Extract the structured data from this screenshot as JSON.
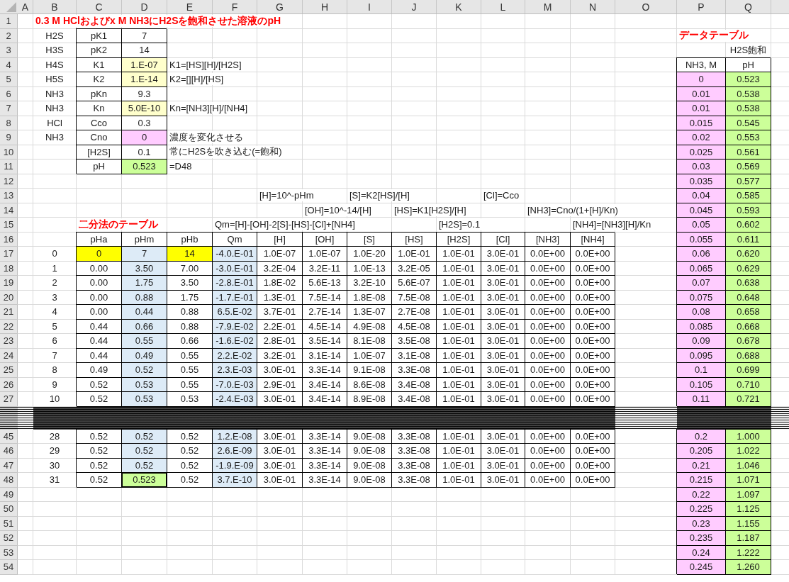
{
  "columns": [
    "A",
    "B",
    "C",
    "D",
    "E",
    "F",
    "G",
    "H",
    "I",
    "J",
    "K",
    "L",
    "M",
    "N",
    "O",
    "P",
    "Q"
  ],
  "rows": [
    {
      "kind": "row",
      "number": "1",
      "cells": [
        null,
        {
          "text": "0.3 M HClおよびx M NH3にH2Sを飽和させた溶液のpH",
          "kind": "title"
        }
      ]
    },
    {
      "kind": "row",
      "number": "2",
      "cells": [
        null,
        {
          "text": "H2S"
        },
        {
          "text": "pK1",
          "boxed": true
        },
        {
          "text": "7",
          "boxed": true
        },
        null,
        null,
        null,
        null,
        null,
        null,
        null,
        null,
        null,
        null,
        null,
        {
          "text": "データテーブル",
          "kind": "title"
        }
      ]
    },
    {
      "kind": "row",
      "number": "3",
      "cells": [
        null,
        {
          "text": "H3S"
        },
        {
          "text": "pK2",
          "boxed": true
        },
        {
          "text": "14",
          "boxed": true
        },
        null,
        null,
        null,
        null,
        null,
        null,
        null,
        null,
        null,
        null,
        null,
        null,
        {
          "text": "H2S飽和"
        }
      ]
    },
    {
      "kind": "row",
      "number": "4",
      "cells": [
        null,
        {
          "text": "H4S"
        },
        {
          "text": "K1",
          "boxed": true
        },
        {
          "text": "1.E-07",
          "boxed": true,
          "color": "#ffffcc"
        },
        {
          "text": "K1=[HS][H]/[H2S]",
          "kind": "note"
        },
        null,
        null,
        null,
        null,
        null,
        null,
        null,
        null,
        null,
        null,
        {
          "text": "NH3, M",
          "boxed": true
        },
        {
          "text": "pH",
          "boxed": true
        }
      ]
    },
    {
      "kind": "row",
      "number": "5",
      "cells": [
        null,
        {
          "text": "H5S"
        },
        {
          "text": "K2",
          "boxed": true
        },
        {
          "text": "1.E-14",
          "boxed": true,
          "color": "#ffffcc"
        },
        {
          "text": "K2=[][H]/[HS]",
          "kind": "note"
        },
        null,
        null,
        null,
        null,
        null,
        null,
        null,
        null,
        null,
        null,
        {
          "text": "0",
          "boxed": true,
          "color": "#ffccff"
        },
        {
          "text": "0.523",
          "boxed": true,
          "color": "#ccff99"
        }
      ]
    },
    {
      "kind": "row",
      "number": "6",
      "cells": [
        null,
        {
          "text": "NH3"
        },
        {
          "text": "pKn",
          "boxed": true
        },
        {
          "text": "9.3",
          "boxed": true
        },
        null,
        null,
        null,
        null,
        null,
        null,
        null,
        null,
        null,
        null,
        null,
        {
          "text": "0.01",
          "boxed": true,
          "color": "#ffccff"
        },
        {
          "text": "0.538",
          "boxed": true,
          "color": "#ccff99"
        }
      ]
    },
    {
      "kind": "row",
      "number": "7",
      "cells": [
        null,
        {
          "text": "NH3"
        },
        {
          "text": "Kn",
          "boxed": true
        },
        {
          "text": "5.0E-10",
          "boxed": true,
          "color": "#ffffcc"
        },
        {
          "text": "Kn=[NH3][H]/[NH4]",
          "kind": "note"
        },
        null,
        null,
        null,
        null,
        null,
        null,
        null,
        null,
        null,
        null,
        {
          "text": "0.01",
          "boxed": true,
          "color": "#ffccff"
        },
        {
          "text": "0.538",
          "boxed": true,
          "color": "#ccff99"
        }
      ]
    },
    {
      "kind": "row",
      "number": "8",
      "cells": [
        null,
        {
          "text": "HCl"
        },
        {
          "text": "Cco",
          "boxed": true
        },
        {
          "text": "0.3",
          "boxed": true
        },
        null,
        null,
        null,
        null,
        null,
        null,
        null,
        null,
        null,
        null,
        null,
        {
          "text": "0.015",
          "boxed": true,
          "color": "#ffccff"
        },
        {
          "text": "0.545",
          "boxed": true,
          "color": "#ccff99"
        }
      ]
    },
    {
      "kind": "row",
      "number": "9",
      "cells": [
        null,
        {
          "text": "NH3"
        },
        {
          "text": "Cno",
          "boxed": true
        },
        {
          "text": "0",
          "boxed": true,
          "color": "#ffccff"
        },
        {
          "text": "濃度を変化させる",
          "kind": "note"
        },
        null,
        null,
        null,
        null,
        null,
        null,
        null,
        null,
        null,
        null,
        {
          "text": "0.02",
          "boxed": true,
          "color": "#ffccff"
        },
        {
          "text": "0.553",
          "boxed": true,
          "color": "#ccff99"
        }
      ]
    },
    {
      "kind": "row",
      "number": "10",
      "cells": [
        null,
        null,
        {
          "text": "[H2S]",
          "boxed": true
        },
        {
          "text": "0.1",
          "boxed": true
        },
        {
          "text": "常にH2Sを吹き込む(=飽和)",
          "kind": "note"
        },
        null,
        null,
        null,
        null,
        null,
        null,
        null,
        null,
        null,
        null,
        {
          "text": "0.025",
          "boxed": true,
          "color": "#ffccff"
        },
        {
          "text": "0.561",
          "boxed": true,
          "color": "#ccff99"
        }
      ]
    },
    {
      "kind": "row",
      "number": "11",
      "cells": [
        null,
        null,
        {
          "text": "pH",
          "boxed": true
        },
        {
          "text": "0.523",
          "boxed": true,
          "color": "#ccff99"
        },
        {
          "text": "=D48",
          "kind": "note"
        },
        null,
        null,
        null,
        null,
        null,
        null,
        null,
        null,
        null,
        null,
        {
          "text": "0.03",
          "boxed": true,
          "color": "#ffccff"
        },
        {
          "text": "0.569",
          "boxed": true,
          "color": "#ccff99"
        }
      ]
    },
    {
      "kind": "row",
      "number": "12",
      "cells": [
        null,
        null,
        null,
        null,
        null,
        null,
        null,
        null,
        null,
        null,
        null,
        null,
        null,
        null,
        null,
        {
          "text": "0.035",
          "boxed": true,
          "color": "#ffccff"
        },
        {
          "text": "0.577",
          "boxed": true,
          "color": "#ccff99"
        }
      ]
    },
    {
      "kind": "row",
      "number": "13",
      "cells": [
        null,
        null,
        null,
        null,
        null,
        null,
        {
          "text": "[H]=10^-pHm",
          "kind": "note"
        },
        null,
        {
          "text": "[S]=K2[HS]/[H]",
          "kind": "note"
        },
        null,
        null,
        {
          "text": "[Cl]=Cco",
          "kind": "note"
        },
        null,
        null,
        null,
        {
          "text": "0.04",
          "boxed": true,
          "color": "#ffccff"
        },
        {
          "text": "0.585",
          "boxed": true,
          "color": "#ccff99"
        }
      ]
    },
    {
      "kind": "row",
      "number": "14",
      "cells": [
        null,
        null,
        null,
        null,
        null,
        null,
        null,
        {
          "text": "[OH]=10^-14/[H]",
          "kind": "note"
        },
        null,
        {
          "text": "[HS]=K1[H2S]/[H]",
          "kind": "note"
        },
        null,
        null,
        {
          "text": "[NH3]=Cno/(1+[H]/Kn)",
          "kind": "note"
        },
        null,
        null,
        {
          "text": "0.045",
          "boxed": true,
          "color": "#ffccff"
        },
        {
          "text": "0.593",
          "boxed": true,
          "color": "#ccff99"
        }
      ]
    },
    {
      "kind": "row",
      "number": "15",
      "cells": [
        null,
        null,
        {
          "text": "二分法のテーブル",
          "kind": "title"
        },
        null,
        null,
        {
          "text": "Qm=[H]-[OH]-2[S]-[HS]-[Cl]+[NH4]",
          "kind": "note"
        },
        null,
        null,
        null,
        null,
        {
          "text": "[H2S]=0.1",
          "kind": "note"
        },
        null,
        null,
        {
          "text": "[NH4]=[NH3][H]/Kn",
          "kind": "note"
        },
        null,
        {
          "text": "0.05",
          "boxed": true,
          "color": "#ffccff"
        },
        {
          "text": "0.602",
          "boxed": true,
          "color": "#ccff99"
        }
      ]
    },
    {
      "kind": "row",
      "number": "16",
      "cells": [
        null,
        null,
        {
          "text": "pHa",
          "boxed": true
        },
        {
          "text": "pHm",
          "boxed": true
        },
        {
          "text": "pHb",
          "boxed": true
        },
        {
          "text": "Qm",
          "boxed": true
        },
        {
          "text": "[H]",
          "boxed": true
        },
        {
          "text": "[OH]",
          "boxed": true
        },
        {
          "text": "[S]",
          "boxed": true
        },
        {
          "text": "[HS]",
          "boxed": true
        },
        {
          "text": "[H2S]",
          "boxed": true
        },
        {
          "text": "[Cl]",
          "boxed": true
        },
        {
          "text": "[NH3]",
          "boxed": true
        },
        {
          "text": "[NH4]",
          "boxed": true
        },
        null,
        {
          "text": "0.055",
          "boxed": true,
          "color": "#ffccff"
        },
        {
          "text": "0.611",
          "boxed": true,
          "color": "#ccff99"
        }
      ]
    },
    {
      "kind": "row",
      "number": "17",
      "cells": [
        null,
        {
          "text": "0"
        },
        {
          "text": "0",
          "boxed": true,
          "color": "#ffff00"
        },
        {
          "text": "7",
          "boxed": true,
          "color": "#ddebf7"
        },
        {
          "text": "14",
          "boxed": true,
          "color": "#ffff00"
        },
        {
          "text": "-4.0.E-01",
          "boxed": true,
          "color": "#ddebf7"
        },
        {
          "text": "1.0E-07",
          "boxed": true
        },
        {
          "text": "1.0E-07",
          "boxed": true
        },
        {
          "text": "1.0E-20",
          "boxed": true
        },
        {
          "text": "1.0E-01",
          "boxed": true
        },
        {
          "text": "1.0E-01",
          "boxed": true
        },
        {
          "text": "3.0E-01",
          "boxed": true
        },
        {
          "text": "0.0E+00",
          "boxed": true
        },
        {
          "text": "0.0E+00",
          "boxed": true
        },
        null,
        {
          "text": "0.06",
          "boxed": true,
          "color": "#ffccff"
        },
        {
          "text": "0.620",
          "boxed": true,
          "color": "#ccff99"
        }
      ]
    },
    {
      "kind": "row",
      "number": "18",
      "cells": [
        null,
        {
          "text": "1"
        },
        {
          "text": "0.00",
          "boxed": true
        },
        {
          "text": "3.50",
          "boxed": true,
          "color": "#ddebf7"
        },
        {
          "text": "7.00",
          "boxed": true
        },
        {
          "text": "-3.0.E-01",
          "boxed": true,
          "color": "#ddebf7"
        },
        {
          "text": "3.2E-04",
          "boxed": true
        },
        {
          "text": "3.2E-11",
          "boxed": true
        },
        {
          "text": "1.0E-13",
          "boxed": true
        },
        {
          "text": "3.2E-05",
          "boxed": true
        },
        {
          "text": "1.0E-01",
          "boxed": true
        },
        {
          "text": "3.0E-01",
          "boxed": true
        },
        {
          "text": "0.0E+00",
          "boxed": true
        },
        {
          "text": "0.0E+00",
          "boxed": true
        },
        null,
        {
          "text": "0.065",
          "boxed": true,
          "color": "#ffccff"
        },
        {
          "text": "0.629",
          "boxed": true,
          "color": "#ccff99"
        }
      ]
    },
    {
      "kind": "row",
      "number": "19",
      "cells": [
        null,
        {
          "text": "2"
        },
        {
          "text": "0.00",
          "boxed": true
        },
        {
          "text": "1.75",
          "boxed": true,
          "color": "#ddebf7"
        },
        {
          "text": "3.50",
          "boxed": true
        },
        {
          "text": "-2.8.E-01",
          "boxed": true,
          "color": "#ddebf7"
        },
        {
          "text": "1.8E-02",
          "boxed": true
        },
        {
          "text": "5.6E-13",
          "boxed": true
        },
        {
          "text": "3.2E-10",
          "boxed": true
        },
        {
          "text": "5.6E-07",
          "boxed": true
        },
        {
          "text": "1.0E-01",
          "boxed": true
        },
        {
          "text": "3.0E-01",
          "boxed": true
        },
        {
          "text": "0.0E+00",
          "boxed": true
        },
        {
          "text": "0.0E+00",
          "boxed": true
        },
        null,
        {
          "text": "0.07",
          "boxed": true,
          "color": "#ffccff"
        },
        {
          "text": "0.638",
          "boxed": true,
          "color": "#ccff99"
        }
      ]
    },
    {
      "kind": "row",
      "number": "20",
      "cells": [
        null,
        {
          "text": "3"
        },
        {
          "text": "0.00",
          "boxed": true
        },
        {
          "text": "0.88",
          "boxed": true,
          "color": "#ddebf7"
        },
        {
          "text": "1.75",
          "boxed": true
        },
        {
          "text": "-1.7.E-01",
          "boxed": true,
          "color": "#ddebf7"
        },
        {
          "text": "1.3E-01",
          "boxed": true
        },
        {
          "text": "7.5E-14",
          "boxed": true
        },
        {
          "text": "1.8E-08",
          "boxed": true
        },
        {
          "text": "7.5E-08",
          "boxed": true
        },
        {
          "text": "1.0E-01",
          "boxed": true
        },
        {
          "text": "3.0E-01",
          "boxed": true
        },
        {
          "text": "0.0E+00",
          "boxed": true
        },
        {
          "text": "0.0E+00",
          "boxed": true
        },
        null,
        {
          "text": "0.075",
          "boxed": true,
          "color": "#ffccff"
        },
        {
          "text": "0.648",
          "boxed": true,
          "color": "#ccff99"
        }
      ]
    },
    {
      "kind": "row",
      "number": "21",
      "cells": [
        null,
        {
          "text": "4"
        },
        {
          "text": "0.00",
          "boxed": true
        },
        {
          "text": "0.44",
          "boxed": true,
          "color": "#ddebf7"
        },
        {
          "text": "0.88",
          "boxed": true
        },
        {
          "text": "6.5.E-02",
          "boxed": true,
          "color": "#ddebf7"
        },
        {
          "text": "3.7E-01",
          "boxed": true
        },
        {
          "text": "2.7E-14",
          "boxed": true
        },
        {
          "text": "1.3E-07",
          "boxed": true
        },
        {
          "text": "2.7E-08",
          "boxed": true
        },
        {
          "text": "1.0E-01",
          "boxed": true
        },
        {
          "text": "3.0E-01",
          "boxed": true
        },
        {
          "text": "0.0E+00",
          "boxed": true
        },
        {
          "text": "0.0E+00",
          "boxed": true
        },
        null,
        {
          "text": "0.08",
          "boxed": true,
          "color": "#ffccff"
        },
        {
          "text": "0.658",
          "boxed": true,
          "color": "#ccff99"
        }
      ]
    },
    {
      "kind": "row",
      "number": "22",
      "cells": [
        null,
        {
          "text": "5"
        },
        {
          "text": "0.44",
          "boxed": true
        },
        {
          "text": "0.66",
          "boxed": true,
          "color": "#ddebf7"
        },
        {
          "text": "0.88",
          "boxed": true
        },
        {
          "text": "-7.9.E-02",
          "boxed": true,
          "color": "#ddebf7"
        },
        {
          "text": "2.2E-01",
          "boxed": true
        },
        {
          "text": "4.5E-14",
          "boxed": true
        },
        {
          "text": "4.9E-08",
          "boxed": true
        },
        {
          "text": "4.5E-08",
          "boxed": true
        },
        {
          "text": "1.0E-01",
          "boxed": true
        },
        {
          "text": "3.0E-01",
          "boxed": true
        },
        {
          "text": "0.0E+00",
          "boxed": true
        },
        {
          "text": "0.0E+00",
          "boxed": true
        },
        null,
        {
          "text": "0.085",
          "boxed": true,
          "color": "#ffccff"
        },
        {
          "text": "0.668",
          "boxed": true,
          "color": "#ccff99"
        }
      ]
    },
    {
      "kind": "row",
      "number": "23",
      "cells": [
        null,
        {
          "text": "6"
        },
        {
          "text": "0.44",
          "boxed": true
        },
        {
          "text": "0.55",
          "boxed": true,
          "color": "#ddebf7"
        },
        {
          "text": "0.66",
          "boxed": true
        },
        {
          "text": "-1.6.E-02",
          "boxed": true,
          "color": "#ddebf7"
        },
        {
          "text": "2.8E-01",
          "boxed": true
        },
        {
          "text": "3.5E-14",
          "boxed": true
        },
        {
          "text": "8.1E-08",
          "boxed": true
        },
        {
          "text": "3.5E-08",
          "boxed": true
        },
        {
          "text": "1.0E-01",
          "boxed": true
        },
        {
          "text": "3.0E-01",
          "boxed": true
        },
        {
          "text": "0.0E+00",
          "boxed": true
        },
        {
          "text": "0.0E+00",
          "boxed": true
        },
        null,
        {
          "text": "0.09",
          "boxed": true,
          "color": "#ffccff"
        },
        {
          "text": "0.678",
          "boxed": true,
          "color": "#ccff99"
        }
      ]
    },
    {
      "kind": "row",
      "number": "24",
      "cells": [
        null,
        {
          "text": "7"
        },
        {
          "text": "0.44",
          "boxed": true
        },
        {
          "text": "0.49",
          "boxed": true,
          "color": "#ddebf7"
        },
        {
          "text": "0.55",
          "boxed": true
        },
        {
          "text": "2.2.E-02",
          "boxed": true,
          "color": "#ddebf7"
        },
        {
          "text": "3.2E-01",
          "boxed": true
        },
        {
          "text": "3.1E-14",
          "boxed": true
        },
        {
          "text": "1.0E-07",
          "boxed": true
        },
        {
          "text": "3.1E-08",
          "boxed": true
        },
        {
          "text": "1.0E-01",
          "boxed": true
        },
        {
          "text": "3.0E-01",
          "boxed": true
        },
        {
          "text": "0.0E+00",
          "boxed": true
        },
        {
          "text": "0.0E+00",
          "boxed": true
        },
        null,
        {
          "text": "0.095",
          "boxed": true,
          "color": "#ffccff"
        },
        {
          "text": "0.688",
          "boxed": true,
          "color": "#ccff99"
        }
      ]
    },
    {
      "kind": "row",
      "number": "25",
      "cells": [
        null,
        {
          "text": "8"
        },
        {
          "text": "0.49",
          "boxed": true
        },
        {
          "text": "0.52",
          "boxed": true,
          "color": "#ddebf7"
        },
        {
          "text": "0.55",
          "boxed": true
        },
        {
          "text": "2.3.E-03",
          "boxed": true,
          "color": "#ddebf7"
        },
        {
          "text": "3.0E-01",
          "boxed": true
        },
        {
          "text": "3.3E-14",
          "boxed": true
        },
        {
          "text": "9.1E-08",
          "boxed": true
        },
        {
          "text": "3.3E-08",
          "boxed": true
        },
        {
          "text": "1.0E-01",
          "boxed": true
        },
        {
          "text": "3.0E-01",
          "boxed": true
        },
        {
          "text": "0.0E+00",
          "boxed": true
        },
        {
          "text": "0.0E+00",
          "boxed": true
        },
        null,
        {
          "text": "0.1",
          "boxed": true,
          "color": "#ffccff"
        },
        {
          "text": "0.699",
          "boxed": true,
          "color": "#ccff99"
        }
      ]
    },
    {
      "kind": "row",
      "number": "26",
      "cells": [
        null,
        {
          "text": "9"
        },
        {
          "text": "0.52",
          "boxed": true
        },
        {
          "text": "0.53",
          "boxed": true,
          "color": "#ddebf7"
        },
        {
          "text": "0.55",
          "boxed": true
        },
        {
          "text": "-7.0.E-03",
          "boxed": true,
          "color": "#ddebf7"
        },
        {
          "text": "2.9E-01",
          "boxed": true
        },
        {
          "text": "3.4E-14",
          "boxed": true
        },
        {
          "text": "8.6E-08",
          "boxed": true
        },
        {
          "text": "3.4E-08",
          "boxed": true
        },
        {
          "text": "1.0E-01",
          "boxed": true
        },
        {
          "text": "3.0E-01",
          "boxed": true
        },
        {
          "text": "0.0E+00",
          "boxed": true
        },
        {
          "text": "0.0E+00",
          "boxed": true
        },
        null,
        {
          "text": "0.105",
          "boxed": true,
          "color": "#ffccff"
        },
        {
          "text": "0.710",
          "boxed": true,
          "color": "#ccff99"
        }
      ]
    },
    {
      "kind": "row",
      "number": "27",
      "cells": [
        null,
        {
          "text": "10"
        },
        {
          "text": "0.52",
          "boxed": true
        },
        {
          "text": "0.53",
          "boxed": true,
          "color": "#ddebf7"
        },
        {
          "text": "0.53",
          "boxed": true
        },
        {
          "text": "-2.4.E-03",
          "boxed": true,
          "color": "#ddebf7"
        },
        {
          "text": "3.0E-01",
          "boxed": true
        },
        {
          "text": "3.4E-14",
          "boxed": true
        },
        {
          "text": "8.9E-08",
          "boxed": true
        },
        {
          "text": "3.4E-08",
          "boxed": true
        },
        {
          "text": "1.0E-01",
          "boxed": true
        },
        {
          "text": "3.0E-01",
          "boxed": true
        },
        {
          "text": "0.0E+00",
          "boxed": true
        },
        {
          "text": "0.0E+00",
          "boxed": true
        },
        null,
        {
          "text": "0.11",
          "boxed": true,
          "color": "#ffccff"
        },
        {
          "text": "0.721",
          "boxed": true,
          "color": "#ccff99"
        }
      ]
    },
    {
      "kind": "collapsed"
    },
    {
      "kind": "row",
      "number": "45",
      "cells": [
        null,
        {
          "text": "28"
        },
        {
          "text": "0.52",
          "boxed": true
        },
        {
          "text": "0.52",
          "boxed": true,
          "color": "#ddebf7"
        },
        {
          "text": "0.52",
          "boxed": true
        },
        {
          "text": "1.2.E-08",
          "boxed": true,
          "color": "#ddebf7"
        },
        {
          "text": "3.0E-01",
          "boxed": true
        },
        {
          "text": "3.3E-14",
          "boxed": true
        },
        {
          "text": "9.0E-08",
          "boxed": true
        },
        {
          "text": "3.3E-08",
          "boxed": true
        },
        {
          "text": "1.0E-01",
          "boxed": true
        },
        {
          "text": "3.0E-01",
          "boxed": true
        },
        {
          "text": "0.0E+00",
          "boxed": true
        },
        {
          "text": "0.0E+00",
          "boxed": true
        },
        null,
        {
          "text": "0.2",
          "boxed": true,
          "color": "#ffccff"
        },
        {
          "text": "1.000",
          "boxed": true,
          "color": "#ccff99"
        }
      ]
    },
    {
      "kind": "row",
      "number": "46",
      "cells": [
        null,
        {
          "text": "29"
        },
        {
          "text": "0.52",
          "boxed": true
        },
        {
          "text": "0.52",
          "boxed": true,
          "color": "#ddebf7"
        },
        {
          "text": "0.52",
          "boxed": true
        },
        {
          "text": "2.6.E-09",
          "boxed": true,
          "color": "#ddebf7"
        },
        {
          "text": "3.0E-01",
          "boxed": true
        },
        {
          "text": "3.3E-14",
          "boxed": true
        },
        {
          "text": "9.0E-08",
          "boxed": true
        },
        {
          "text": "3.3E-08",
          "boxed": true
        },
        {
          "text": "1.0E-01",
          "boxed": true
        },
        {
          "text": "3.0E-01",
          "boxed": true
        },
        {
          "text": "0.0E+00",
          "boxed": true
        },
        {
          "text": "0.0E+00",
          "boxed": true
        },
        null,
        {
          "text": "0.205",
          "boxed": true,
          "color": "#ffccff"
        },
        {
          "text": "1.022",
          "boxed": true,
          "color": "#ccff99"
        }
      ]
    },
    {
      "kind": "row",
      "number": "47",
      "cells": [
        null,
        {
          "text": "30"
        },
        {
          "text": "0.52",
          "boxed": true
        },
        {
          "text": "0.52",
          "boxed": true,
          "color": "#ddebf7"
        },
        {
          "text": "0.52",
          "boxed": true
        },
        {
          "text": "-1.9.E-09",
          "boxed": true,
          "color": "#ddebf7"
        },
        {
          "text": "3.0E-01",
          "boxed": true
        },
        {
          "text": "3.3E-14",
          "boxed": true
        },
        {
          "text": "9.0E-08",
          "boxed": true
        },
        {
          "text": "3.3E-08",
          "boxed": true
        },
        {
          "text": "1.0E-01",
          "boxed": true
        },
        {
          "text": "3.0E-01",
          "boxed": true
        },
        {
          "text": "0.0E+00",
          "boxed": true
        },
        {
          "text": "0.0E+00",
          "boxed": true
        },
        null,
        {
          "text": "0.21",
          "boxed": true,
          "color": "#ffccff"
        },
        {
          "text": "1.046",
          "boxed": true,
          "color": "#ccff99"
        }
      ]
    },
    {
      "kind": "row",
      "number": "48",
      "cells": [
        null,
        {
          "text": "31"
        },
        {
          "text": "0.52",
          "boxed": true
        },
        {
          "text": "0.523",
          "boxed": true,
          "color": "#ccff99",
          "selected": true
        },
        {
          "text": "0.52",
          "boxed": true
        },
        {
          "text": "3.7.E-10",
          "boxed": true,
          "color": "#ddebf7"
        },
        {
          "text": "3.0E-01",
          "boxed": true
        },
        {
          "text": "3.3E-14",
          "boxed": true
        },
        {
          "text": "9.0E-08",
          "boxed": true
        },
        {
          "text": "3.3E-08",
          "boxed": true
        },
        {
          "text": "1.0E-01",
          "boxed": true
        },
        {
          "text": "3.0E-01",
          "boxed": true
        },
        {
          "text": "0.0E+00",
          "boxed": true
        },
        {
          "text": "0.0E+00",
          "boxed": true
        },
        null,
        {
          "text": "0.215",
          "boxed": true,
          "color": "#ffccff"
        },
        {
          "text": "1.071",
          "boxed": true,
          "color": "#ccff99"
        }
      ]
    },
    {
      "kind": "row",
      "number": "49",
      "cells": [
        null,
        null,
        null,
        null,
        null,
        null,
        null,
        null,
        null,
        null,
        null,
        null,
        null,
        null,
        null,
        {
          "text": "0.22",
          "boxed": true,
          "color": "#ffccff"
        },
        {
          "text": "1.097",
          "boxed": true,
          "color": "#ccff99"
        }
      ]
    },
    {
      "kind": "row",
      "number": "50",
      "cells": [
        null,
        null,
        null,
        null,
        null,
        null,
        null,
        null,
        null,
        null,
        null,
        null,
        null,
        null,
        null,
        {
          "text": "0.225",
          "boxed": true,
          "color": "#ffccff"
        },
        {
          "text": "1.125",
          "boxed": true,
          "color": "#ccff99"
        }
      ]
    },
    {
      "kind": "row",
      "number": "51",
      "cells": [
        null,
        null,
        null,
        null,
        null,
        null,
        null,
        null,
        null,
        null,
        null,
        null,
        null,
        null,
        null,
        {
          "text": "0.23",
          "boxed": true,
          "color": "#ffccff"
        },
        {
          "text": "1.155",
          "boxed": true,
          "color": "#ccff99"
        }
      ]
    },
    {
      "kind": "row",
      "number": "52",
      "cells": [
        null,
        null,
        null,
        null,
        null,
        null,
        null,
        null,
        null,
        null,
        null,
        null,
        null,
        null,
        null,
        {
          "text": "0.235",
          "boxed": true,
          "color": "#ffccff"
        },
        {
          "text": "1.187",
          "boxed": true,
          "color": "#ccff99"
        }
      ]
    },
    {
      "kind": "row",
      "number": "53",
      "cells": [
        null,
        null,
        null,
        null,
        null,
        null,
        null,
        null,
        null,
        null,
        null,
        null,
        null,
        null,
        null,
        {
          "text": "0.24",
          "boxed": true,
          "color": "#ffccff"
        },
        {
          "text": "1.222",
          "boxed": true,
          "color": "#ccff99"
        }
      ]
    },
    {
      "kind": "row",
      "number": "54",
      "cells": [
        null,
        null,
        null,
        null,
        null,
        null,
        null,
        null,
        null,
        null,
        null,
        null,
        null,
        null,
        null,
        {
          "text": "0.245",
          "boxed": true,
          "color": "#ffccff"
        },
        {
          "text": "1.260",
          "boxed": true,
          "color": "#ccff99"
        }
      ]
    }
  ]
}
